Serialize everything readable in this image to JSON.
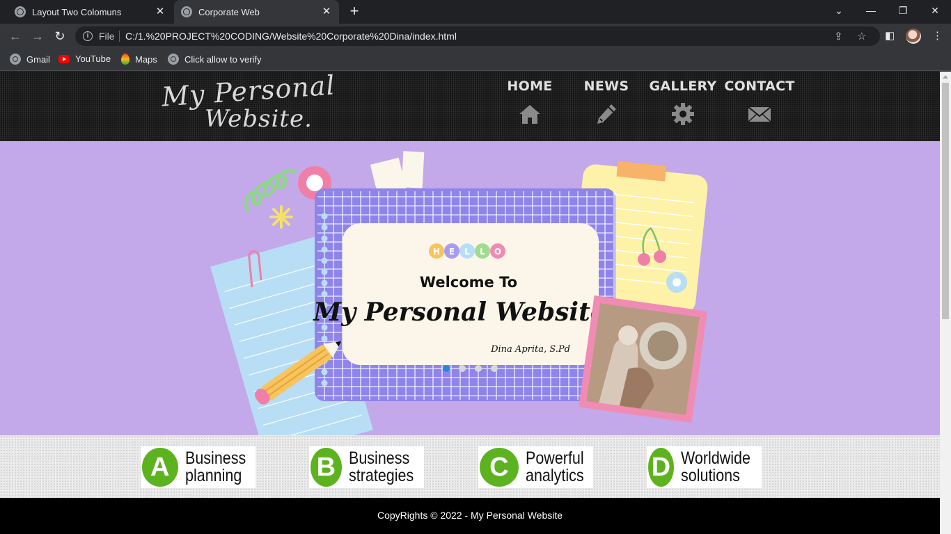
{
  "browser": {
    "tabs": [
      {
        "title": "Layout Two Colomuns",
        "active": false
      },
      {
        "title": "Corporate Web",
        "active": true
      }
    ],
    "address": {
      "scheme_label": "File",
      "url": "C:/1.%20PROJECT%20CODING/Website%20Corporate%20Dina/index.html"
    },
    "bookmarks": [
      {
        "label": "Gmail",
        "icon": "globe-icon"
      },
      {
        "label": "YouTube",
        "icon": "youtube-icon"
      },
      {
        "label": "Maps",
        "icon": "maps-icon"
      },
      {
        "label": "Click allow to verify",
        "icon": "globe-icon"
      }
    ]
  },
  "site": {
    "logo": {
      "line1": "My Personal",
      "line2": "Website."
    },
    "nav": [
      {
        "label": "HOME",
        "icon": "home-icon"
      },
      {
        "label": "NEWS",
        "icon": "pencil-icon"
      },
      {
        "label": "GALLERY",
        "icon": "gear-icon"
      },
      {
        "label": "CONTACT",
        "icon": "mail-icon"
      }
    ],
    "hero": {
      "hello_letters": [
        "H",
        "E",
        "L",
        "L",
        "O"
      ],
      "welcome": "Welcome To",
      "title": "My Personal Website..",
      "signature": "Dina Aprita, S.Pd",
      "slides": 4,
      "active_slide": 1,
      "background": "#c3a9ea"
    },
    "features": [
      {
        "letter": "A",
        "line1": "Business",
        "line2": "planning"
      },
      {
        "letter": "B",
        "line1": "Business",
        "line2": "strategies"
      },
      {
        "letter": "C",
        "line1": "Powerful",
        "line2": "analytics"
      },
      {
        "letter": "D",
        "line1": "Worldwide",
        "line2": "solutions"
      }
    ],
    "footer": "CopyRights © 2022 - My Personal Website"
  },
  "colors": {
    "accent_green": "#5db31f",
    "header_bg": "#161616",
    "hero_bg": "#c3a9ea"
  }
}
